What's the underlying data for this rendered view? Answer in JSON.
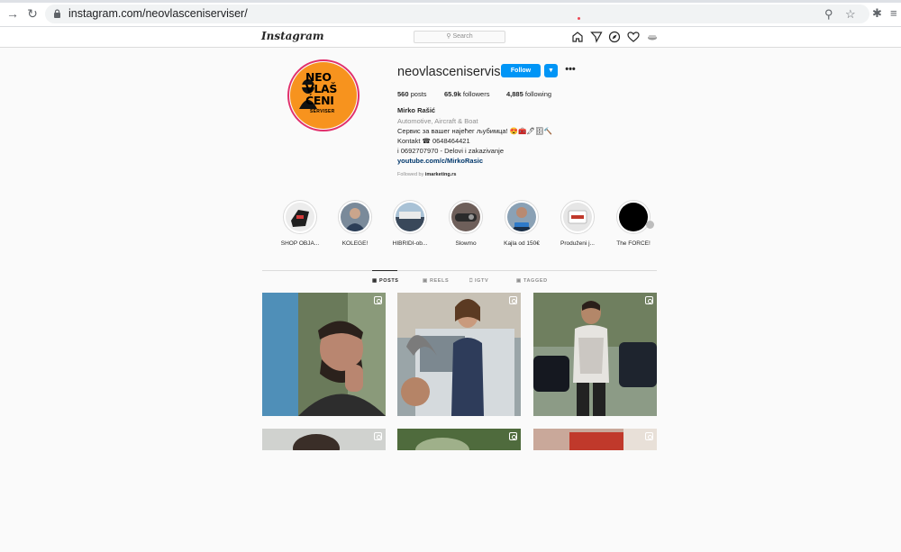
{
  "browser": {
    "url": "instagram.com/neovlasceniserviser/",
    "back_icon": "arrow-right-icon",
    "reload_icon": "reload-icon"
  },
  "header": {
    "logo": "Instagram",
    "search_placeholder": "Search"
  },
  "profile": {
    "avatar_text": "NEO VLAŠ ĆENI",
    "avatar_sub": "SERVISER",
    "username": "neovlasceniserviser",
    "follow_label": "Follow",
    "stats": {
      "posts_count": "560",
      "posts_label": "posts",
      "followers_count": "65.9k",
      "followers_label": "followers",
      "following_count": "4,885",
      "following_label": "following"
    },
    "name": "Mirko Rašić",
    "category": "Automotive, Aircraft & Boat",
    "bio_line1": "Сервис за вашег најећег љубимца! 😍🧰🖊🗄🔨",
    "bio_line2": "Kontakt ☎ 0648464421",
    "bio_line3": "i 0692707970 - Delovi i zakazivanje",
    "link": "youtube.com/c/MirkoRasic",
    "followed_by_prefix": "Followed by",
    "followed_by_name": "imarketing.rs"
  },
  "highlights": [
    {
      "label": "SHOP OBJA...",
      "color": "#3a3a3a"
    },
    {
      "label": "KOLEGE!",
      "color": "#4b5a6e"
    },
    {
      "label": "HIBRIDI-ob...",
      "color": "#5b6f80"
    },
    {
      "label": "Slowmo",
      "color": "#5a4b48"
    },
    {
      "label": "Kajla od 150€",
      "color": "#3f5b78"
    },
    {
      "label": "Produženi j...",
      "color": "#d9d9d9"
    },
    {
      "label": "The FORCE!",
      "color": "#000000"
    }
  ],
  "tabs": [
    "POSTS",
    "REELS",
    "IGTV",
    "TAGGED"
  ],
  "colors": {
    "accent": "#0095f6",
    "avatar_bg": "#f7931e",
    "story_ring": "#e1306c"
  }
}
